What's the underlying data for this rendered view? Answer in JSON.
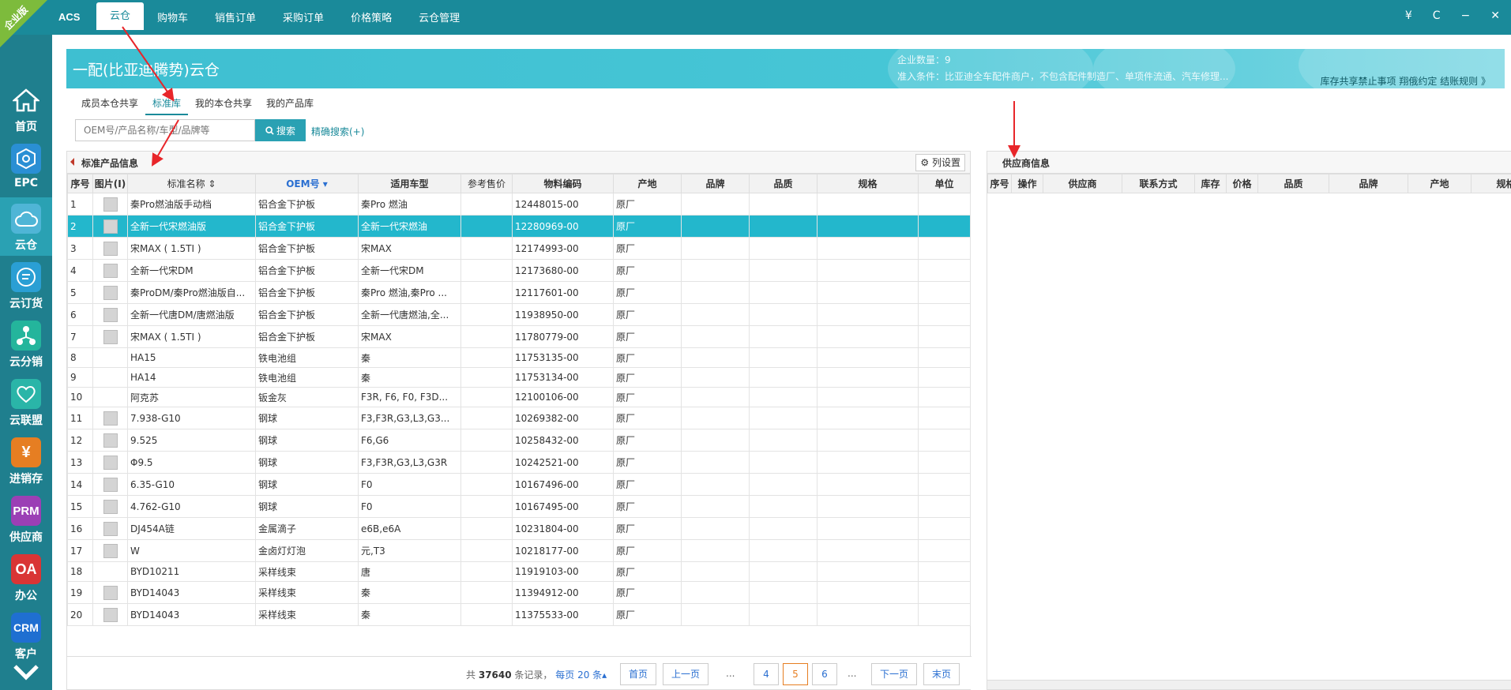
{
  "badge": "企业版",
  "brand": "ACS",
  "top_tabs": [
    "云仓",
    "购物车",
    "销售订单",
    "采购订单",
    "价格策略",
    "云仓管理"
  ],
  "top_right": {
    "yen": "¥",
    "refresh": "C",
    "min": "−",
    "close": "✕"
  },
  "sidebar": [
    {
      "label": "首页",
      "icon": "home-icon",
      "color": "#1f7f8e"
    },
    {
      "label": "EPC",
      "icon": "hexagon-icon",
      "color": "#2a8fd4"
    },
    {
      "label": "云仓",
      "icon": "cloud-icon",
      "color": "#4fb5d6"
    },
    {
      "label": "云订货",
      "icon": "chat-icon",
      "color": "#2a9fd4"
    },
    {
      "label": "云分销",
      "icon": "network-icon",
      "color": "#24b59c"
    },
    {
      "label": "云联盟",
      "icon": "handshake-icon",
      "color": "#2ab5a8"
    },
    {
      "label": "进销存",
      "icon": "yen-icon",
      "color": "#e67e22"
    },
    {
      "label": "供应商",
      "icon": "prm-icon",
      "icon_text": "PRM",
      "color": "#9b3fb5"
    },
    {
      "label": "办公",
      "icon": "oa-icon",
      "icon_text": "OA",
      "color": "#d93535"
    },
    {
      "label": "客户",
      "icon": "crm-icon",
      "icon_text": "CRM",
      "color": "#1f6fd1"
    }
  ],
  "banner": {
    "title": "一配(比亚迪腾势)云仓",
    "company_count": "企业数量：9",
    "admission": "准入条件：比亚迪全车配件商户，不包含配件制造厂、单项件流通、汽车修理...",
    "link": "库存共享禁止事项 翔俄约定 结账规则 》"
  },
  "sub_tabs": [
    "成员本仓共享",
    "标准库",
    "我的本仓共享",
    "我的产品库"
  ],
  "search": {
    "placeholder": "OEM号/产品名称/车型/品牌等",
    "button": "搜索",
    "precise": "精确搜索(+)"
  },
  "left_panel": {
    "title": "标准产品信息",
    "col_setting": "列设置",
    "columns": [
      "序号",
      "图片(I)",
      "标准名称 ⇕",
      "OEM号 ▾",
      "适用车型",
      "参考售价",
      "物料编码",
      "产地",
      "品牌",
      "品质",
      "规格",
      "单位"
    ],
    "rows": [
      [
        "1",
        "img",
        "秦Pro燃油版手动档",
        "铝合金下护板",
        "秦Pro 燃油",
        "",
        "12448015-00",
        "原厂"
      ],
      [
        "2",
        "img",
        "全新一代宋燃油版",
        "铝合金下护板",
        "全新一代宋燃油",
        "",
        "12280969-00",
        "原厂"
      ],
      [
        "3",
        "img",
        "宋MAX ( 1.5TI )",
        "铝合金下护板",
        "宋MAX",
        "",
        "12174993-00",
        "原厂"
      ],
      [
        "4",
        "img",
        "全新一代宋DM",
        "铝合金下护板",
        "全新一代宋DM",
        "",
        "12173680-00",
        "原厂"
      ],
      [
        "5",
        "img",
        "秦ProDM/秦Pro燃油版自...",
        "铝合金下护板",
        "秦Pro 燃油,秦Pro ...",
        "",
        "12117601-00",
        "原厂"
      ],
      [
        "6",
        "img",
        "全新一代唐DM/唐燃油版",
        "铝合金下护板",
        "全新一代唐燃油,全...",
        "",
        "11938950-00",
        "原厂"
      ],
      [
        "7",
        "img",
        "宋MAX ( 1.5TI )",
        "铝合金下护板",
        "宋MAX",
        "",
        "11780779-00",
        "原厂"
      ],
      [
        "8",
        "",
        "HA15",
        "铁电池组",
        "秦",
        "",
        "11753135-00",
        "原厂"
      ],
      [
        "9",
        "",
        "HA14",
        "铁电池组",
        "秦",
        "",
        "11753134-00",
        "原厂"
      ],
      [
        "10",
        "",
        "阿克苏",
        "钣金灰",
        "F3R, F6, F0, F3D...",
        "",
        "12100106-00",
        "原厂"
      ],
      [
        "11",
        "img",
        "7.938-G10",
        "钢球",
        "F3,F3R,G3,L3,G3...",
        "",
        "10269382-00",
        "原厂"
      ],
      [
        "12",
        "img",
        "9.525",
        "钢球",
        "F6,G6",
        "",
        "10258432-00",
        "原厂"
      ],
      [
        "13",
        "img",
        "Φ9.5",
        "钢球",
        "F3,F3R,G3,L3,G3R",
        "",
        "10242521-00",
        "原厂"
      ],
      [
        "14",
        "img",
        "6.35-G10",
        "钢球",
        "F0",
        "",
        "10167496-00",
        "原厂"
      ],
      [
        "15",
        "img",
        "4.762-G10",
        "钢球",
        "F0",
        "",
        "10167495-00",
        "原厂"
      ],
      [
        "16",
        "img",
        "DJ454A链",
        "金属滴子",
        "e6B,e6A",
        "",
        "10231804-00",
        "原厂"
      ],
      [
        "17",
        "img",
        "W",
        "金卤灯灯泡",
        "元,T3",
        "",
        "10218177-00",
        "原厂"
      ],
      [
        "18",
        "",
        "BYD10211",
        "采样线束",
        "唐",
        "",
        "11919103-00",
        "原厂"
      ],
      [
        "19",
        "img",
        "BYD14043",
        "采样线束",
        "秦",
        "",
        "11394912-00",
        "原厂"
      ],
      [
        "20",
        "img",
        "BYD14043",
        "采样线束",
        "秦",
        "",
        "11375533-00",
        "原厂"
      ]
    ],
    "selected_row": 1
  },
  "pager": {
    "prefix": "共",
    "total": "37640",
    "suffix": "条记录，",
    "per_page": "每页 20 条▴",
    "first": "首页",
    "prev": "上一页",
    "pages": [
      "4",
      "5",
      "6"
    ],
    "current": "5",
    "dots": "...",
    "next": "下一页",
    "last": "末页"
  },
  "right_panel": {
    "title": "供应商信息",
    "columns": [
      "序号",
      "操作",
      "供应商",
      "联系方式",
      "库存",
      "价格",
      "品质",
      "品牌",
      "产地",
      "规格"
    ]
  }
}
